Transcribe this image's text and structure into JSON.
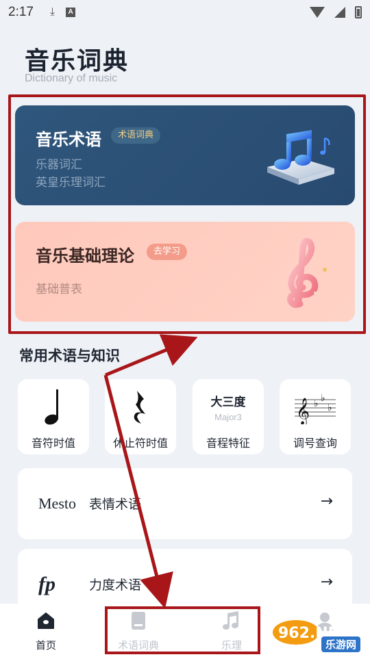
{
  "status_bar": {
    "time": "2:17"
  },
  "header": {
    "title": "音乐词典",
    "subtitle": "Dictionary of music"
  },
  "cards": [
    {
      "title": "音乐术语",
      "tag": "术语词典",
      "lines": [
        "乐器词汇",
        "英皇乐理词汇"
      ]
    },
    {
      "title": "音乐基础理论",
      "tag": "去学习",
      "lines": [
        "基础普表"
      ]
    }
  ],
  "section": {
    "title": "常用术语与知识"
  },
  "quick_items": [
    {
      "label": "音符时值",
      "icon": "quarter-note-icon"
    },
    {
      "label": "休止符时值",
      "icon": "quarter-rest-icon"
    },
    {
      "label": "音程特征",
      "big": "大三度",
      "small": "Major3"
    },
    {
      "label": "调号查询",
      "icon": "key-signature-icon"
    }
  ],
  "list_items": [
    {
      "icon_text": "Mesto",
      "label": "表情术语",
      "arrow": "→"
    },
    {
      "icon_text": "fp",
      "label": "力度术语",
      "arrow": "→"
    }
  ],
  "bottom_nav": [
    {
      "label": "首页",
      "icon": "home-icon",
      "active": true
    },
    {
      "label": "术语词典",
      "icon": "book-icon",
      "active": false
    },
    {
      "label": "乐理",
      "icon": "music-note-icon",
      "active": false
    }
  ],
  "watermark": {
    "brand": "962.NET",
    "site": "乐游网"
  },
  "colors": {
    "terms_card": "#2f567c",
    "theory_card": "#ffc9bc",
    "annotation_red": "#a8161a"
  }
}
